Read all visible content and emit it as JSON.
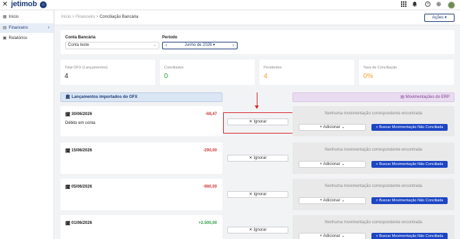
{
  "app": {
    "logo": "jetimob"
  },
  "topbar": {
    "close_glyph": "✕",
    "logo_badge": "⌂",
    "icons": [
      "grid-icon",
      "bell-icon",
      "help-icon",
      "settings-icon"
    ]
  },
  "sidebar": {
    "items": [
      {
        "label": "Início",
        "icon": "home-icon"
      },
      {
        "label": "Financeiro",
        "icon": "finance-icon",
        "active": true
      },
      {
        "label": "Relatórios",
        "icon": "reports-icon"
      }
    ]
  },
  "breadcrumb": {
    "items": [
      "Início",
      "Financeiro"
    ],
    "current": "Conciliação Bancária",
    "separator": ">"
  },
  "actions_button": {
    "label": "Ações ▾"
  },
  "filters": {
    "account_label": "Conta Bancária",
    "account_value": "Conta teste",
    "period_label": "Período",
    "period_value": "Junho de 2026 ▾"
  },
  "stats": [
    {
      "label": "Total OFX (Lançamentos)",
      "value": "4",
      "color": "#222222"
    },
    {
      "label": "Conciliados",
      "value": "0",
      "color": "#2e9d47"
    },
    {
      "label": "Pendentes",
      "value": "4",
      "color": "#f0a030"
    },
    {
      "label": "Taxa de Conciliação",
      "value": "0%",
      "color": "#f0a030"
    }
  ],
  "sections": {
    "left_title": "Lançamentos importados do OFX",
    "right_title": "Movimentações do ERP"
  },
  "ignore_label": "Ignorar",
  "add_label": "Adicionar",
  "search_label": "Buscar Movimentação Não Conciliada",
  "no_match_text": "Nenhuma movimentação correspondente encontrada",
  "transactions": [
    {
      "date": "30/06/2026",
      "amount": "-68,47",
      "description": "Débito em conta"
    },
    {
      "date": "15/06/2026",
      "amount": "-290,00"
    },
    {
      "date": "05/06/2026",
      "amount": "-980,00"
    },
    {
      "date": "01/06/2026",
      "amount": "+2.500,00"
    }
  ],
  "colors": {
    "brand": "#1d3a78",
    "primary_button": "#1c46c4",
    "negative": "#d23a3a",
    "positive": "#2e9d47",
    "highlight": "#d8262c"
  }
}
